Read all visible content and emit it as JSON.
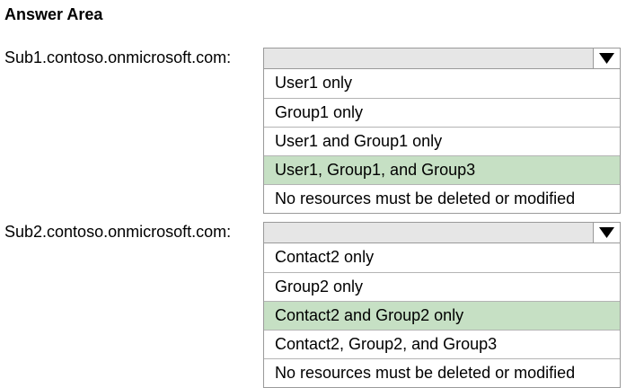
{
  "heading": "Answer Area",
  "questions": [
    {
      "label": "Sub1.contoso.onmicrosoft.com:",
      "options": [
        "User1 only",
        "Group1 only",
        "User1 and Group1 only",
        "User1, Group1, and Group3",
        "No resources must be deleted or modified"
      ],
      "selected_index": 3
    },
    {
      "label": "Sub2.contoso.onmicrosoft.com:",
      "options": [
        "Contact2 only",
        "Group2 only",
        "Contact2 and Group2 only",
        "Contact2, Group2, and Group3",
        "No resources must be deleted or modified"
      ],
      "selected_index": 2
    }
  ],
  "colors": {
    "selected_highlight": "#c6e0c4",
    "dropdown_background": "#e6e6e6",
    "border": "#9a9a9a"
  },
  "icons": {
    "dropdown_arrow": "triangle-down-icon"
  }
}
